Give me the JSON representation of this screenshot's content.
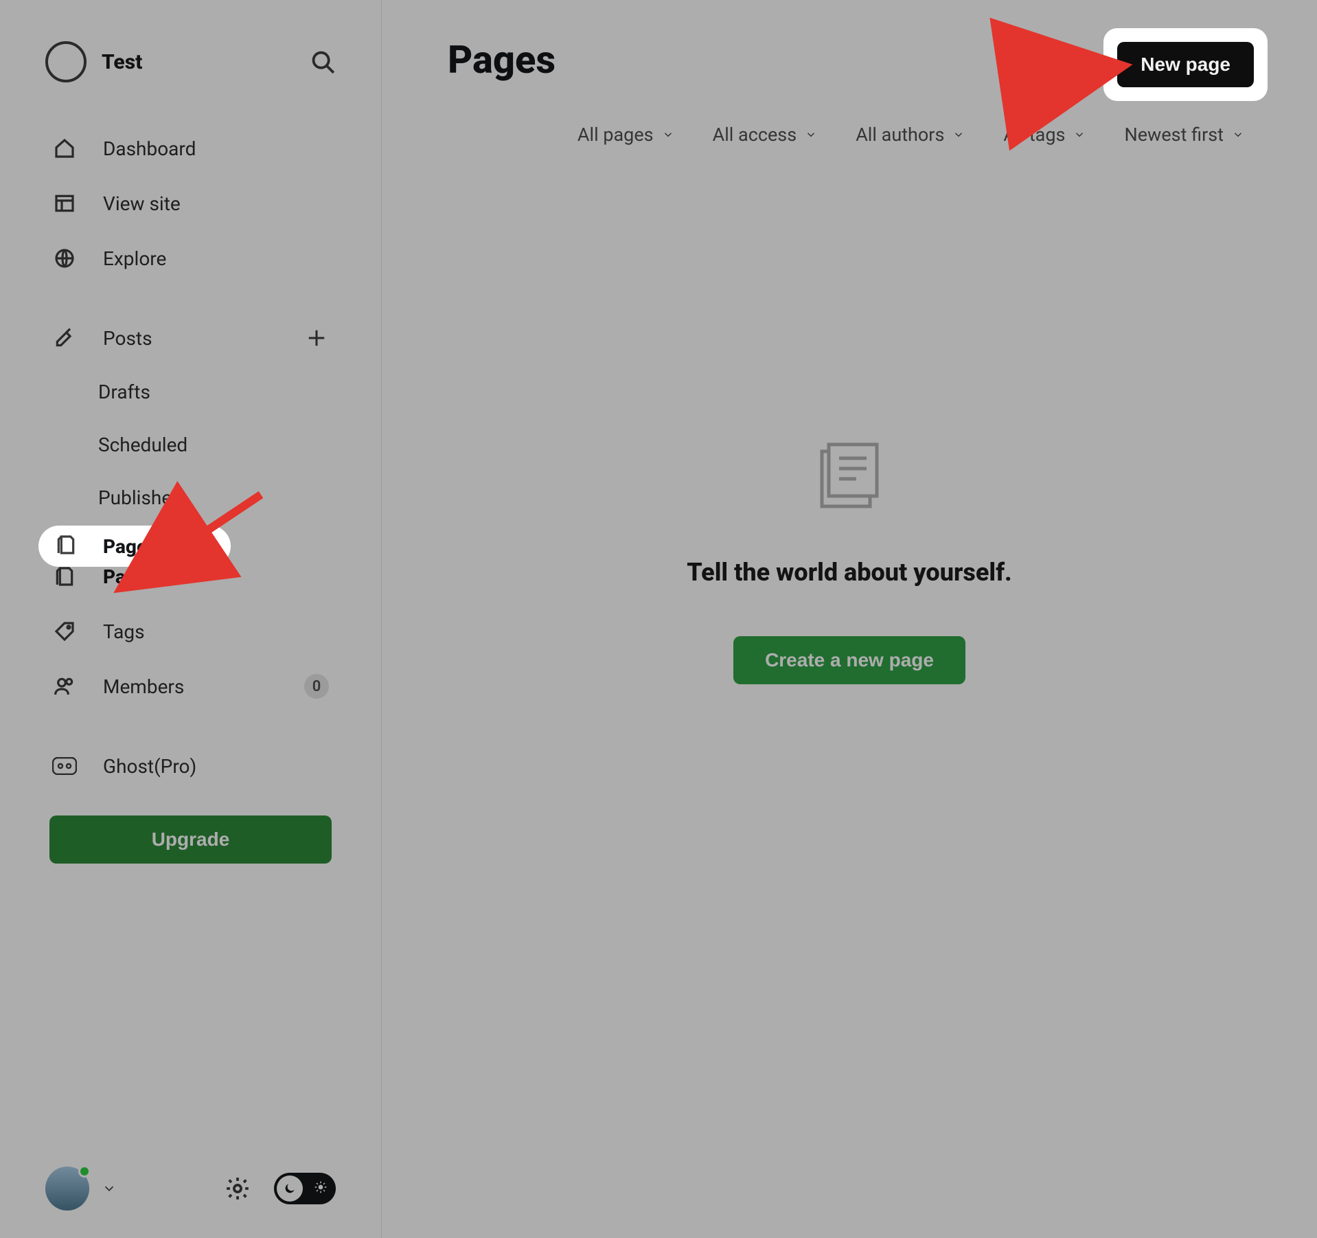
{
  "site_name": "Test",
  "sidebar": {
    "dashboard": "Dashboard",
    "view_site": "View site",
    "explore": "Explore",
    "posts": "Posts",
    "drafts": "Drafts",
    "scheduled": "Scheduled",
    "published": "Published",
    "pages": "Pages",
    "tags": "Tags",
    "members": "Members",
    "members_count": "0",
    "ghost_pro": "Ghost(Pro)",
    "upgrade": "Upgrade"
  },
  "header": {
    "title": "Pages",
    "new_page": "New page"
  },
  "filters": {
    "pages": "All pages",
    "access": "All access",
    "authors": "All authors",
    "tags": "All tags",
    "sort": "Newest first"
  },
  "empty": {
    "title": "Tell the world about yourself.",
    "cta": "Create a new page"
  },
  "highlight": {
    "pages_label": "Pages"
  }
}
